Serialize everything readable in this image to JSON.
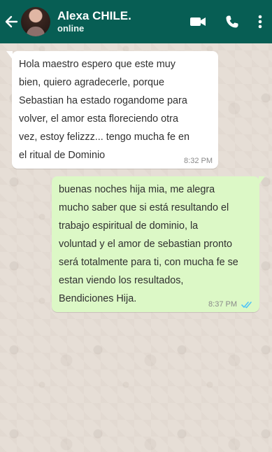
{
  "header": {
    "contact_name": "Alexa CHILE.",
    "status": "online",
    "back_icon": "arrow-left-icon",
    "video_icon": "video-call-icon",
    "phone_icon": "phone-call-icon",
    "menu_icon": "more-vert-icon",
    "bg_color": "#075e54"
  },
  "messages": [
    {
      "direction": "incoming",
      "text": "Hola maestro espero que este muy\nbien, quiero agradecerle, porque\nSebastian ha estado rogandome para\nvolver, el amor esta floreciendo otra\nvez, estoy felizzz... tengo mucha fe en\nel ritual de Dominio",
      "time": "8:32 PM"
    },
    {
      "direction": "outgoing",
      "text": "buenas noches hija mia, me alegra\nmucho saber que si está resultando el\ntrabajo espiritual de dominio, la\nvoluntad y el amor de sebastian pronto\nserá totalmente para ti, con mucha fe se\nestan viendo los resultados,\nBendiciones Hija.",
      "time": "8:37 PM",
      "read_icon": "double-check-icon",
      "read_color": "#4fc3f7"
    }
  ],
  "colors": {
    "incoming_bubble": "#ffffff",
    "outgoing_bubble": "#dcf8c6",
    "wallpaper": "#e6ded6"
  }
}
